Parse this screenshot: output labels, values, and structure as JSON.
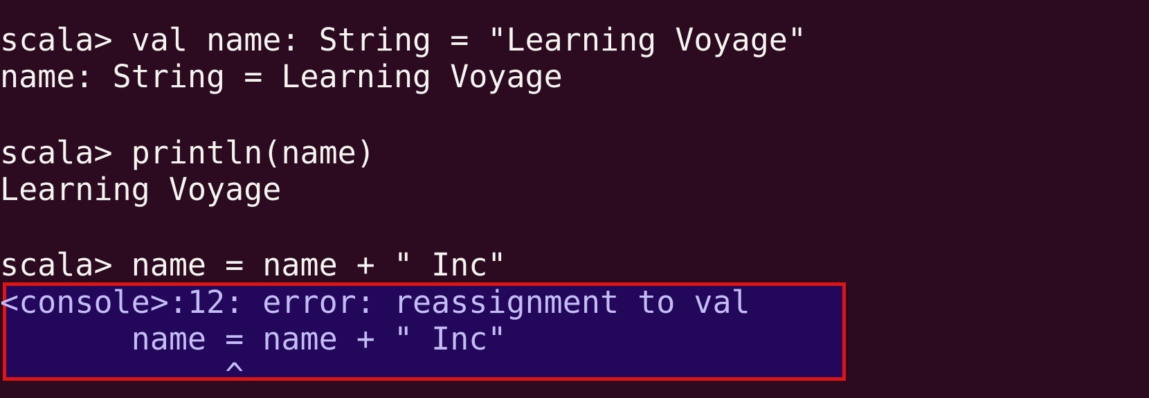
{
  "colors": {
    "background": "#2c0b21",
    "text": "#f5f5f0",
    "error_text": "#c3bdf5",
    "error_background": "#22075a",
    "highlight_border": "#e11414"
  },
  "terminal": {
    "lines": [
      "scala> val name: String = \"Learning Voyage\"",
      "name: String = Learning Voyage",
      "scala> println(name)",
      "Learning Voyage",
      "scala> name = name + \" Inc\""
    ],
    "error_lines": [
      "<console>:12: error: reassignment to val",
      "       name = name + \" Inc\"",
      "            ^"
    ]
  }
}
